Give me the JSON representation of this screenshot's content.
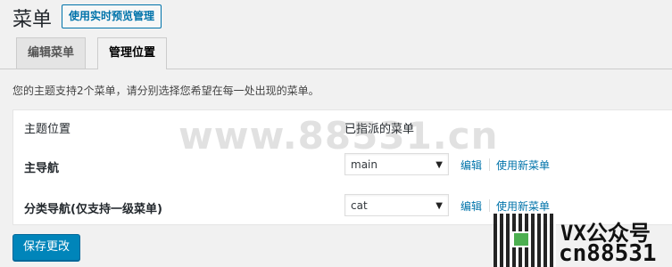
{
  "header": {
    "title": "菜单",
    "live_preview_button": "使用实时预览管理"
  },
  "tabs": [
    {
      "label": "编辑菜单",
      "active": false
    },
    {
      "label": "管理位置",
      "active": true
    }
  ],
  "description": "您的主题支持2个菜单，请分别选择您希望在每一处出现的菜单。",
  "table": {
    "columns": [
      "主题位置",
      "已指派的菜单"
    ],
    "rows": [
      {
        "location": "主导航",
        "menu": "main",
        "edit_link": "编辑",
        "new_link": "使用新菜单"
      },
      {
        "location": "分类导航(仅支持一级菜单)",
        "menu": "cat",
        "edit_link": "编辑",
        "new_link": "使用新菜单"
      }
    ]
  },
  "save_button": "保存更改",
  "watermark": "www.88531.cn",
  "brand": {
    "line1": "VX公众号",
    "line2": "cn88531"
  },
  "colors": {
    "accent": "#0073aa",
    "primary_button": "#0085ba"
  }
}
